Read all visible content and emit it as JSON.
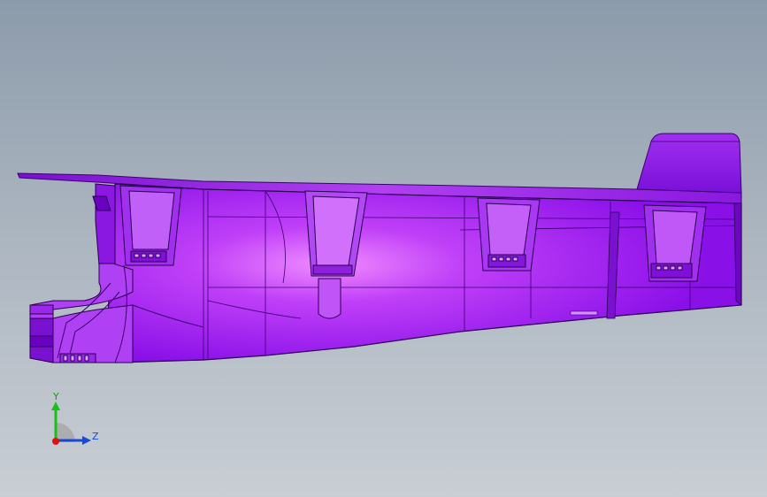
{
  "viewport": {
    "background_top": "#8c9bab",
    "background_bottom": "#c9ced4"
  },
  "model": {
    "color_main": "#9a1df0",
    "color_light": "#e070ff",
    "color_dark": "#6a00c0",
    "edge_color": "#2a0050"
  },
  "triad": {
    "y_label": "Y",
    "z_label": "Z",
    "y_color": "#18c018",
    "z_color": "#1848d8",
    "x_color": "#e01010"
  }
}
